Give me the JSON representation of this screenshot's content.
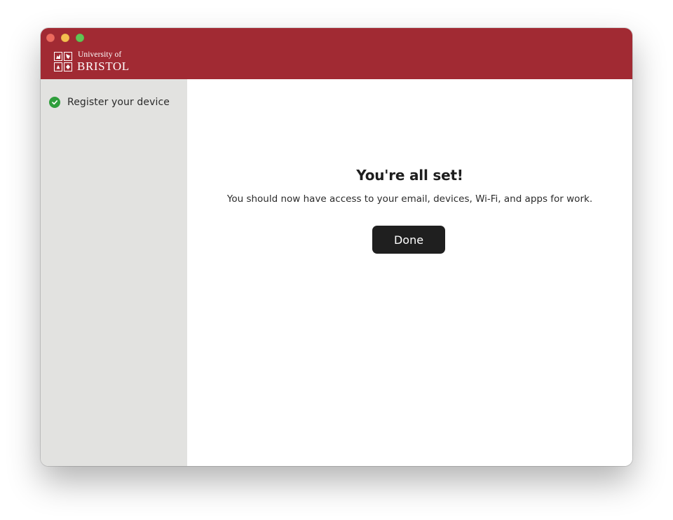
{
  "window": {
    "traffic_lights": [
      "close",
      "minimize",
      "zoom"
    ]
  },
  "header": {
    "brand_color": "#a12a33",
    "logo": {
      "line1": "University of",
      "line2": "BRISTOL"
    }
  },
  "sidebar": {
    "background": "#e2e2e0",
    "steps": [
      {
        "label": "Register your device",
        "status": "complete",
        "icon": "checkmark-circle-icon",
        "color": "#2f9e3c"
      }
    ]
  },
  "main": {
    "title": "You're all set!",
    "message": "You should now have access to your email, devices, Wi-Fi, and apps for work.",
    "done_label": "Done"
  }
}
